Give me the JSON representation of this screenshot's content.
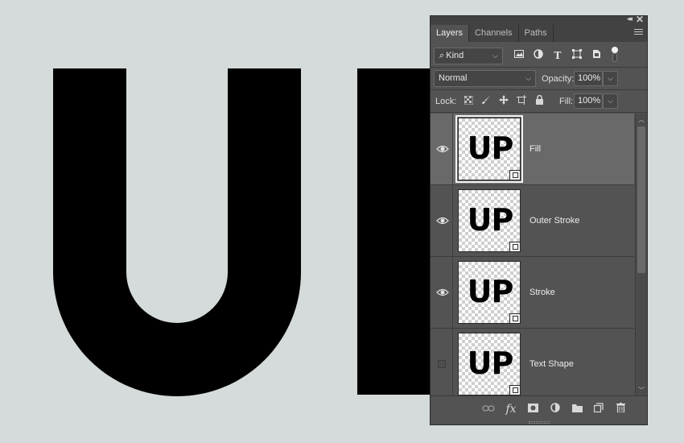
{
  "panel": {
    "controls": {
      "collapse": "◂◂",
      "close": "✕"
    },
    "tabs": [
      {
        "label": "Layers",
        "active": true
      },
      {
        "label": "Channels",
        "active": false
      },
      {
        "label": "Paths",
        "active": false
      }
    ],
    "filter": {
      "kind_label": "Kind",
      "kind_icon": "search-icon",
      "icons": [
        "image-filter-icon",
        "adjustment-filter-icon",
        "type-filter-icon",
        "shape-filter-icon",
        "smart-object-filter-icon"
      ]
    },
    "blend": {
      "mode": "Normal",
      "opacity_label": "Opacity:",
      "opacity": "100%"
    },
    "lock": {
      "label": "Lock:",
      "icons": [
        "lock-transparent-icon",
        "lock-image-icon",
        "lock-position-icon",
        "lock-artboard-icon",
        "lock-all-icon"
      ],
      "fill_label": "Fill:",
      "fill": "100%"
    },
    "layers": [
      {
        "name": "Fill",
        "thumb_text": "UP",
        "visible": true,
        "selected": true
      },
      {
        "name": "Outer Stroke",
        "thumb_text": "UP",
        "visible": true,
        "selected": false
      },
      {
        "name": "Stroke",
        "thumb_text": "UP",
        "visible": true,
        "selected": false
      },
      {
        "name": "Text Shape",
        "thumb_text": "UP",
        "visible": false,
        "selected": false
      }
    ],
    "footer_icons": [
      "link-icon",
      "fx-icon",
      "mask-icon",
      "adjustment-layer-icon",
      "folder-icon",
      "new-layer-icon",
      "trash-icon"
    ],
    "fx_label": "fx"
  }
}
